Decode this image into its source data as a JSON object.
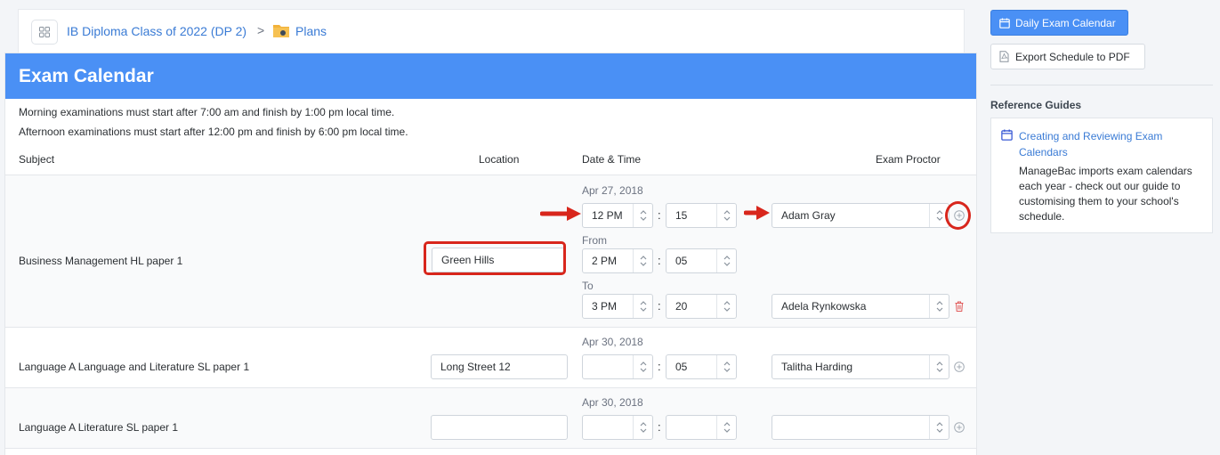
{
  "breadcrumb": {
    "class_name": "IB Diploma Class of 2022 (DP 2)",
    "separator": ">",
    "plans": "Plans"
  },
  "card": {
    "title": "Exam Calendar",
    "notes": [
      "Morning examinations must start after 7:00 am and finish by 1:00 pm local time.",
      "Afternoon examinations must start after 12:00 pm and finish by 6:00 pm local time."
    ],
    "columns": {
      "subject": "Subject",
      "location": "Location",
      "datetime": "Date & Time",
      "proctor": "Exam Proctor"
    }
  },
  "rows": [
    {
      "subject": "Business Management HL paper 1",
      "date": "Apr 27, 2018",
      "location": "Green Hills",
      "start_hour": "12 PM",
      "start_min": "15",
      "start_proctor": "Adam Gray",
      "from_label": "From",
      "from_hour": "2 PM",
      "from_min": "05",
      "to_label": "To",
      "to_hour": "3 PM",
      "to_min": "20",
      "to_proctor": "Adela Rynkowska"
    },
    {
      "subject": "Language A Language and Literature SL paper 1",
      "date": "Apr 30, 2018",
      "location": "Long Street 12",
      "hour": "",
      "min": "05",
      "proctor": "Talitha Harding"
    },
    {
      "subject": "Language A Literature SL paper 1",
      "date": "Apr 30, 2018",
      "location": "",
      "hour": "",
      "min": "",
      "proctor": ""
    }
  ],
  "sidebar": {
    "daily_btn": "Daily Exam Calendar",
    "export_btn": "Export Schedule to PDF",
    "ref_title": "Reference Guides",
    "guide_link": "Creating and Reviewing Exam Calendars",
    "guide_text": "ManageBac imports exam calendars each year - check out our guide to customising them to your school's schedule."
  },
  "colors": {
    "accent": "#4a90f5",
    "link": "#3a7bd5",
    "annotation": "#d8261c",
    "delete": "#e05a5a"
  }
}
